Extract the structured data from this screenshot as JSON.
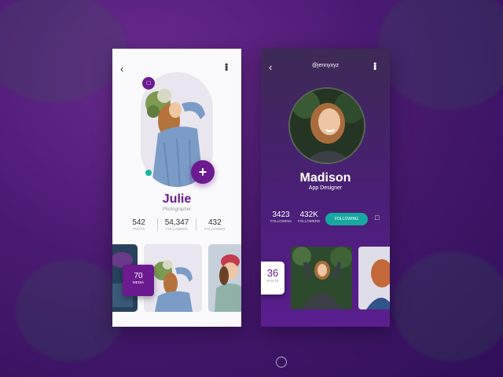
{
  "colors": {
    "accent": "#6b1b8f",
    "teal": "#17a9a0",
    "status_dot": "#17b6a4"
  },
  "left_profile": {
    "name": "Julie",
    "role": "Photographer",
    "stats": [
      {
        "value": "542",
        "label": "POSTS"
      },
      {
        "value": "54,347",
        "label": "FOLLOWERS"
      },
      {
        "value": "432",
        "label": "FOLLOWING"
      }
    ],
    "media_count": "70",
    "media_label": "MEDIA",
    "icons": {
      "back": "chevron-left-icon",
      "more": "more-vertical-icon",
      "chat": "chat-icon",
      "add": "plus-icon"
    }
  },
  "right_profile": {
    "handle": "@jennyxyz",
    "name": "Madison",
    "role": "App Designer",
    "stats": [
      {
        "value": "3423",
        "label": "FOLLOWING"
      },
      {
        "value": "432K",
        "label": "FOLLOWERS"
      }
    ],
    "follow_button": "FOLLOWING",
    "posts_count": "36",
    "posts_label": "POSTS",
    "icons": {
      "back": "chevron-left-icon",
      "more": "more-vertical-icon",
      "chat": "chat-icon"
    }
  }
}
